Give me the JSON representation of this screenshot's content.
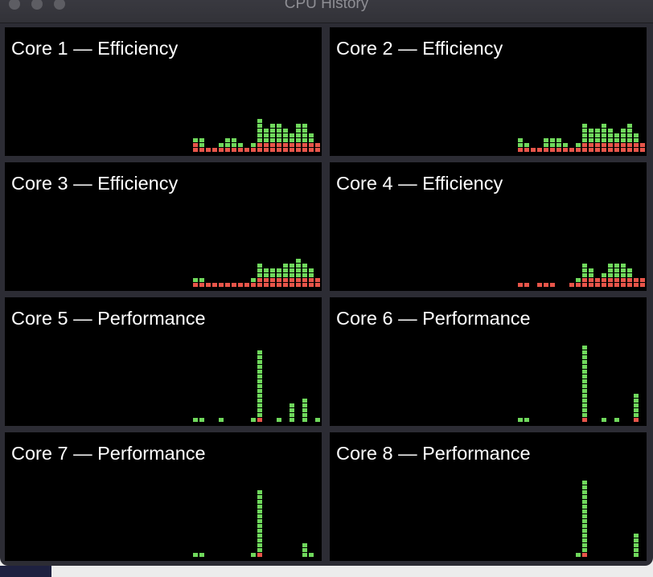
{
  "window": {
    "title": "CPU History"
  },
  "colors": {
    "user": "#6fd85c",
    "system": "#e8554a",
    "background": "#000000",
    "frame": "#2c2c34"
  },
  "cores": [
    {
      "label": "Core 1 — Efficiency",
      "system": [
        2,
        1,
        1,
        1,
        1,
        1,
        1,
        1,
        1,
        1,
        2,
        2,
        2,
        2,
        2,
        2,
        2,
        2,
        2,
        2
      ],
      "user": [
        1,
        2,
        0,
        0,
        1,
        2,
        2,
        1,
        0,
        1,
        5,
        3,
        4,
        4,
        3,
        2,
        4,
        4,
        2,
        0
      ]
    },
    {
      "label": "Core 2 — Efficiency",
      "system": [
        1,
        1,
        1,
        1,
        1,
        1,
        1,
        1,
        1,
        1,
        2,
        2,
        2,
        2,
        2,
        2,
        2,
        2,
        2,
        2
      ],
      "user": [
        2,
        1,
        0,
        0,
        2,
        2,
        2,
        1,
        0,
        1,
        4,
        3,
        3,
        4,
        3,
        2,
        3,
        4,
        2,
        0
      ]
    },
    {
      "label": "Core 3 — Efficiency",
      "system": [
        1,
        1,
        1,
        1,
        1,
        1,
        1,
        1,
        1,
        1,
        2,
        2,
        2,
        2,
        2,
        2,
        2,
        2,
        2,
        2
      ],
      "user": [
        1,
        1,
        0,
        0,
        0,
        0,
        0,
        0,
        0,
        1,
        3,
        2,
        2,
        2,
        3,
        3,
        4,
        3,
        2,
        0
      ]
    },
    {
      "label": "Core 4 — Efficiency",
      "system": [
        1,
        1,
        0,
        1,
        1,
        1,
        0,
        0,
        1,
        1,
        2,
        2,
        2,
        2,
        2,
        2,
        2,
        2,
        2,
        2
      ],
      "user": [
        0,
        0,
        0,
        0,
        0,
        0,
        0,
        0,
        0,
        1,
        3,
        2,
        0,
        1,
        3,
        3,
        3,
        2,
        0,
        0
      ]
    },
    {
      "label": "Core 5 — Performance",
      "system": [
        0,
        0,
        0,
        0,
        0,
        0,
        0,
        0,
        0,
        0,
        1,
        0,
        0,
        0,
        0,
        0,
        0,
        0,
        0,
        0
      ],
      "user": [
        1,
        1,
        0,
        0,
        1,
        0,
        0,
        0,
        0,
        1,
        14,
        0,
        0,
        1,
        0,
        4,
        0,
        5,
        0,
        1
      ]
    },
    {
      "label": "Core 6 — Performance",
      "system": [
        0,
        0,
        0,
        0,
        0,
        0,
        0,
        0,
        0,
        0,
        1,
        0,
        0,
        0,
        0,
        0,
        0,
        0,
        1,
        0
      ],
      "user": [
        1,
        1,
        0,
        0,
        0,
        0,
        0,
        0,
        0,
        0,
        15,
        0,
        0,
        1,
        0,
        1,
        0,
        0,
        5,
        0
      ]
    },
    {
      "label": "Core 7 — Performance",
      "system": [
        0,
        0,
        0,
        0,
        0,
        0,
        0,
        0,
        0,
        0,
        1,
        0,
        0,
        0,
        0,
        0,
        0,
        0,
        0,
        0
      ],
      "user": [
        1,
        1,
        0,
        0,
        0,
        0,
        0,
        0,
        0,
        1,
        13,
        0,
        0,
        0,
        0,
        0,
        0,
        3,
        1,
        0
      ]
    },
    {
      "label": "Core 8 — Performance",
      "system": [
        0,
        0,
        0,
        0,
        0,
        0,
        0,
        0,
        0,
        0,
        1,
        0,
        0,
        0,
        0,
        0,
        0,
        0,
        0,
        0
      ],
      "user": [
        0,
        0,
        0,
        0,
        0,
        0,
        0,
        0,
        0,
        1,
        15,
        0,
        0,
        0,
        0,
        0,
        0,
        0,
        5,
        0
      ]
    }
  ]
}
